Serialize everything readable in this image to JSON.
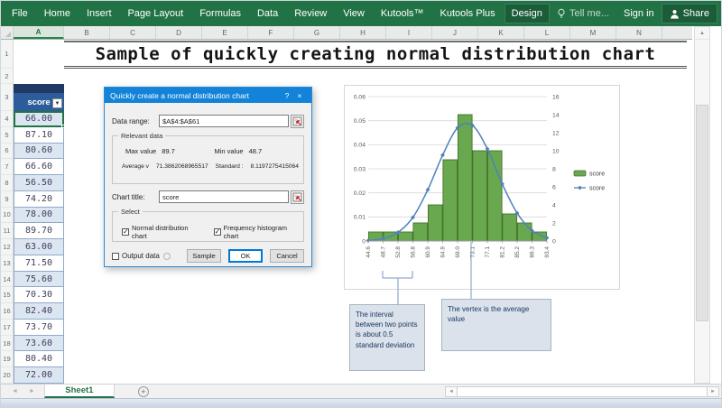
{
  "ribbon": {
    "tabs": [
      "File",
      "Home",
      "Insert",
      "Page Layout",
      "Formulas",
      "Data",
      "Review",
      "View",
      "Kutools™",
      "Kutools Plus",
      "Design"
    ],
    "active_tab": "Design",
    "tell_me": "Tell me...",
    "sign_in": "Sign in",
    "share": "Share",
    "green": "#217346"
  },
  "sheet": {
    "column_headers": [
      "A",
      "B",
      "C",
      "D",
      "E",
      "F",
      "G",
      "H",
      "I",
      "J",
      "K",
      "L",
      "M",
      "N"
    ],
    "selected_column": "A",
    "row_numbers": [
      "1",
      "2",
      "3",
      "4",
      "5",
      "6",
      "7",
      "8",
      "9",
      "10",
      "11",
      "12",
      "13",
      "14",
      "15",
      "16",
      "17",
      "18",
      "19",
      "20"
    ],
    "title": "Sample of quickly creating normal distribution chart",
    "sheet_tab": "Sheet1",
    "new_sheet_button": "+"
  },
  "table": {
    "header": "score",
    "values": [
      "66.00",
      "87.10",
      "80.60",
      "66.60",
      "56.50",
      "74.20",
      "78.00",
      "89.70",
      "63.00",
      "71.50",
      "75.60",
      "70.30",
      "82.40",
      "73.70",
      "73.60",
      "80.40",
      "72.00"
    ],
    "header_color": "#2d5c9b",
    "band_color": "#1f3864",
    "alt_row_color": "#dce6f1"
  },
  "dialog": {
    "title": "Quickly create a normal distribution chart",
    "help_button": "?",
    "close_button": "×",
    "data_range_label": "Data range:",
    "data_range_value": "$A$4:$A$61",
    "relevant_data_label": "Relevant data",
    "max_label": "Max value",
    "max_value": "89.7",
    "min_label": "Min value",
    "min_value": "48.7",
    "average_label": "Average v",
    "average_value": "71.3862068965517",
    "standard_label": "Standard :",
    "standard_value": "8.1197275415064",
    "chart_title_label": "Chart title:",
    "chart_title_value": "score",
    "select_label": "Select",
    "checkbox_normal": "Normal distribution chart",
    "checkbox_histogram": "Frequency histogram chart",
    "output_data_label": "Output data",
    "sample_button": "Sample",
    "ok_button": "OK",
    "cancel_button": "Cancel"
  },
  "chart_data": {
    "type": "bar",
    "subtype": "histogram with normal distribution line, dual axis",
    "bin_labels": [
      "44.6",
      "48.7",
      "52.8",
      "56.8",
      "60.9",
      "64.9",
      "69.0",
      "73.1",
      "77.1",
      "81.2",
      "85.2",
      "89.3",
      "93.4"
    ],
    "bar_counts": [
      1,
      1,
      1,
      2,
      4,
      9,
      14,
      10,
      10,
      3,
      2,
      1
    ],
    "curve_values": [
      0.0002,
      0.001,
      0.0036,
      0.0098,
      0.0213,
      0.0357,
      0.047,
      0.048,
      0.0383,
      0.0237,
      0.0116,
      0.0043,
      0.0013
    ],
    "left_axis": {
      "min": 0,
      "max": 0.06,
      "step": 0.01
    },
    "right_axis": {
      "min": 0,
      "max": 16,
      "step": 2
    },
    "legend": [
      {
        "label": "score",
        "type": "bar"
      },
      {
        "label": "score",
        "type": "line"
      }
    ],
    "legend_position": "right",
    "grid": true,
    "colors": {
      "bar": "#6aa84f",
      "bar_border": "#45722c",
      "line": "#4f81bd"
    }
  },
  "callouts": [
    {
      "text": "The interval between two points is about 0.5 standard deviation"
    },
    {
      "text": "The vertex is the average value"
    }
  ]
}
